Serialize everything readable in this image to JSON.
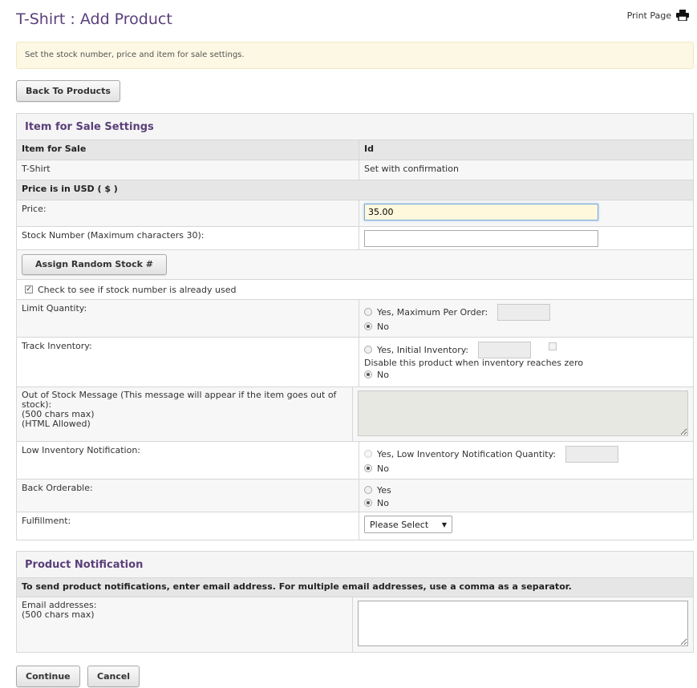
{
  "header": {
    "title": "T-Shirt : Add Product",
    "print_label": "Print Page",
    "print_icon": "printer-icon"
  },
  "alert": {
    "text": "Set the stock number, price and item for sale settings."
  },
  "back_button": "Back To Products",
  "sale_settings": {
    "heading": "Item for Sale Settings",
    "col_item": "Item for Sale",
    "col_id": "Id",
    "item_value": "T-Shirt",
    "id_value": "Set with confirmation",
    "price_header": "Price is in USD ( $ )",
    "price_label": "Price:",
    "price_value": "35.00",
    "stock_label": "Stock Number (Maximum characters 30):",
    "stock_value": "",
    "random_button": "Assign Random Stock #",
    "check_stock_label": "Check to see if stock number is already used",
    "check_stock_checked": true,
    "limit_label": "Limit Quantity:",
    "limit_yes": "Yes, Maximum Per Order:",
    "limit_no": "No",
    "limit_selected": "No",
    "track_label": "Track Inventory:",
    "track_yes": "Yes, Initial Inventory:",
    "track_disable": "Disable this product when inventory reaches zero",
    "track_no": "No",
    "track_selected": "No",
    "oos_label_1": "Out of Stock Message (This message will appear if the item goes out of stock):",
    "oos_label_2": "(500 chars max)",
    "oos_label_3": "(HTML Allowed)",
    "low_label": "Low Inventory Notification:",
    "low_yes": "Yes, Low Inventory Notification Quantity:",
    "low_no": "No",
    "low_selected": "No",
    "back_label": "Back Orderable:",
    "back_yes": "Yes",
    "back_no": "No",
    "back_selected": "No",
    "fulfillment_label": "Fulfillment:",
    "fulfillment_value": "Please Select"
  },
  "notification": {
    "heading": "Product Notification",
    "instructions": "To send product notifications, enter email address. For multiple email addresses, use a comma as a separator.",
    "email_label": "Email addresses:",
    "email_hint": "(500 chars max)",
    "email_value": ""
  },
  "footer": {
    "continue": "Continue",
    "cancel": "Cancel"
  },
  "colors": {
    "title": "#5a3f7a",
    "alert_bg": "#fcf8e3",
    "header_row": "#e6e6e6",
    "focus_bg": "#fff8dc"
  }
}
